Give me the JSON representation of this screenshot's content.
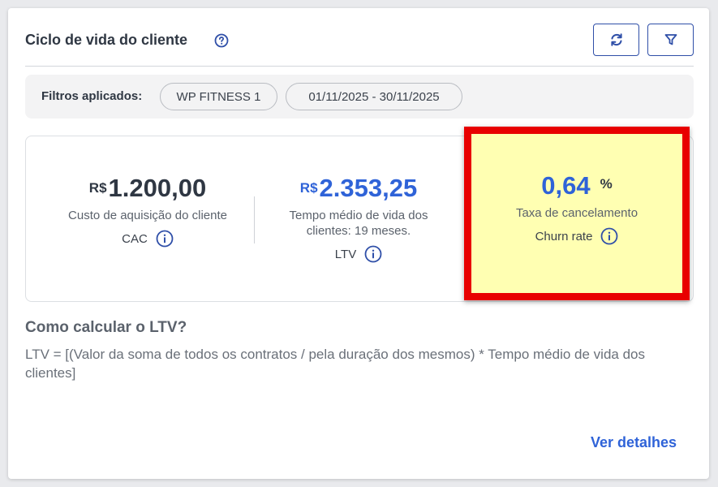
{
  "header": {
    "title": "Ciclo de vida do cliente"
  },
  "filters": {
    "label": "Filtros aplicados:",
    "chips": [
      "WP FITNESS 1",
      "01/11/2025 - 30/11/2025"
    ]
  },
  "metrics": {
    "cac": {
      "currency": "R$",
      "value": "1.200,00",
      "label": "Custo de aquisição do cliente",
      "code": "CAC"
    },
    "ltv": {
      "currency": "R$",
      "value": "2.353,25",
      "label_line1": "Tempo médio de vida dos",
      "label_line2": "clientes: 19 meses.",
      "code": "LTV"
    },
    "churn": {
      "value": "0,64",
      "unit": "%",
      "label": "Taxa de cancelamento",
      "code": "Churn rate"
    }
  },
  "how_to": {
    "title": "Como calcular o LTV?",
    "text": "LTV = [(Valor da soma de todos os contratos / pela duração dos mesmos) * Tempo médio de vida dos clientes]"
  },
  "footer": {
    "details_link": "Ver detalhes"
  },
  "colors": {
    "accent": "#2f63d8",
    "highlight_border": "#e80000",
    "highlight_fill": "#ffffb2"
  },
  "icons": {
    "help": "question-circle-icon",
    "refresh": "refresh-icon",
    "filter": "filter-icon",
    "info": "info-circle-icon"
  }
}
